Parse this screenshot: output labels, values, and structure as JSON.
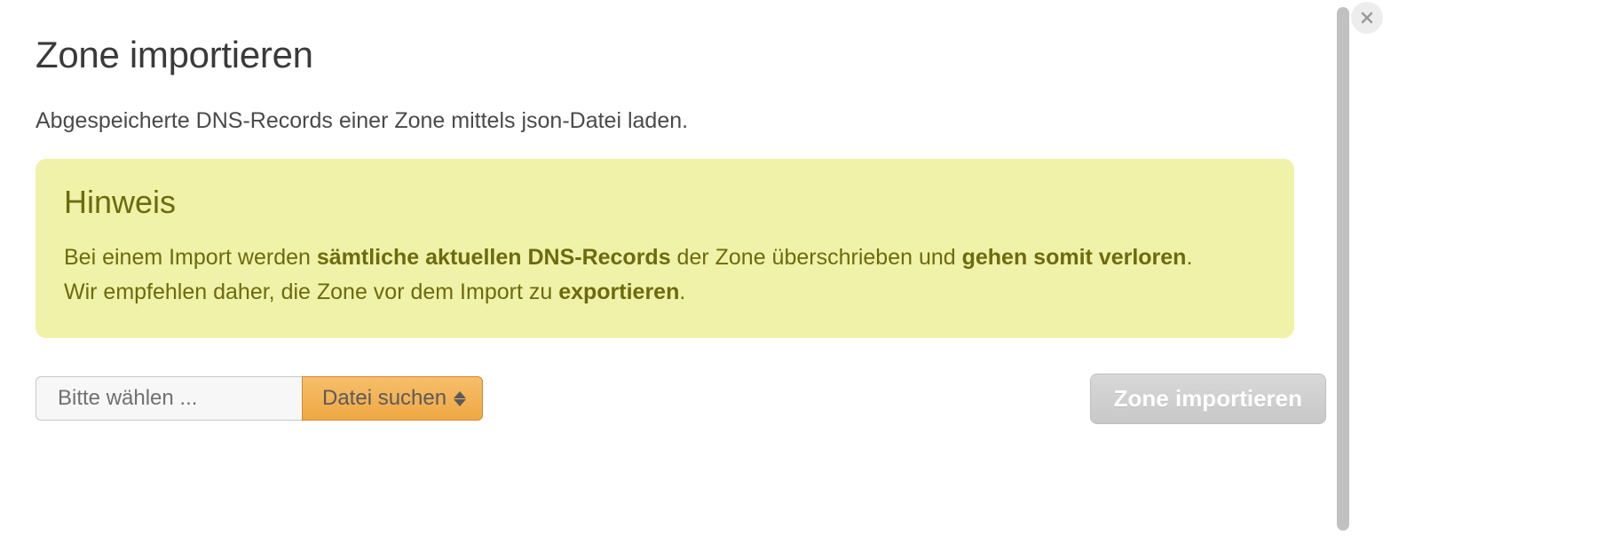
{
  "title": "Zone importieren",
  "description": "Abgespeicherte DNS-Records einer Zone mittels json-Datei laden.",
  "notice": {
    "title": "Hinweis",
    "line1_part1": "Bei einem Import werden ",
    "line1_bold1": "sämtliche aktuellen DNS-Records",
    "line1_part2": " der Zone überschrieben und ",
    "line1_bold2": "gehen somit verloren",
    "line1_part3": ".",
    "line2_part1": "Wir empfehlen daher, die Zone vor dem Import zu ",
    "line2_bold1": "exportieren",
    "line2_part2": "."
  },
  "file_select": {
    "placeholder": "Bitte wählen ...",
    "browse_label": "Datei suchen"
  },
  "import_button": "Zone importieren"
}
